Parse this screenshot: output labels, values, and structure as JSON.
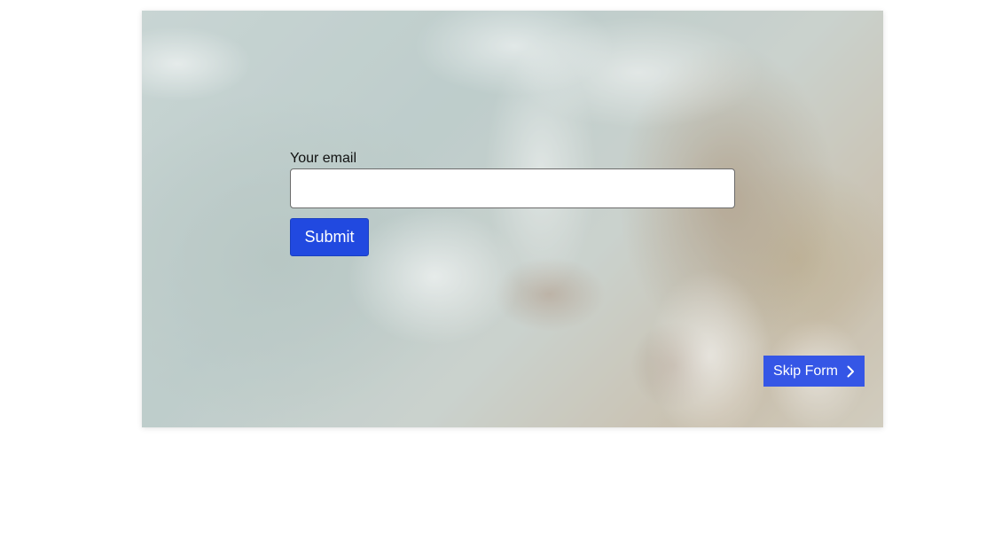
{
  "form": {
    "email_label": "Your email",
    "email_value": "",
    "email_placeholder": "",
    "submit_label": "Submit"
  },
  "skip": {
    "label": "Skip Form",
    "icon": "chevron-right-icon"
  },
  "colors": {
    "accent": "#2149e0",
    "skip_button": "#3556e6"
  }
}
